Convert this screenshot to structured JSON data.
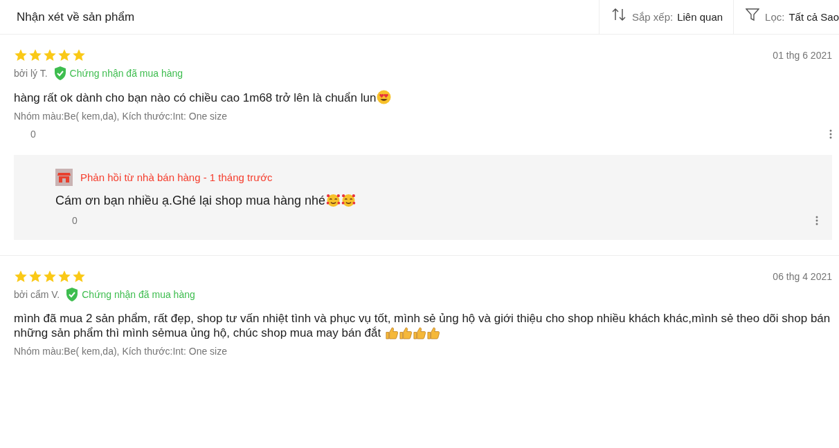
{
  "header": {
    "title": "Nhận xét về sản phẩm",
    "sort": {
      "label": "Sắp xếp:",
      "value": "Liên quan"
    },
    "filter": {
      "label": "Lọc:",
      "value": "Tất cả Sao"
    }
  },
  "reviews": [
    {
      "stars": 5,
      "date": "01 thg 6 2021",
      "author": "bởi lý T.",
      "verified": true,
      "verified_label": "Chứng nhận đã mua hàng",
      "text": "hàng rất ok dành cho bạn nào có chiều cao 1m68 trở lên  là chuẩn lun",
      "emojis": [
        {
          "kind": "heart-eyes"
        }
      ],
      "variant": "Nhóm màu:Be( kem,da), Kích thước:Int: One size",
      "likes": "0",
      "reply": {
        "title": "Phản hồi từ nhà bán hàng - 1 tháng trước",
        "text": "Cám ơn bạn nhiều ạ.Ghé lại shop mua hàng nhé",
        "emojis": [
          {
            "kind": "hearts-smile"
          },
          {
            "kind": "hearts-smile"
          }
        ],
        "likes": "0"
      }
    },
    {
      "stars": 5,
      "date": "06 thg 4 2021",
      "author": "bởi cẩm V.",
      "verified": true,
      "verified_label": "Chứng nhận đã mua hàng",
      "text": "mình đã mua 2 sản phẩm, rất đẹp, shop tư vấn nhiệt tình và phục vụ tốt, mình sẻ ủng hộ và giới thiệu cho shop nhiều khách khác,mình sẻ theo dõi shop bán những sản phẩm thì mình sẻmua ủng hộ, chúc shop mua may bán đắt ",
      "emojis": [
        {
          "kind": "thumbs-up"
        },
        {
          "kind": "thumbs-up"
        },
        {
          "kind": "thumbs-up"
        },
        {
          "kind": "thumbs-up"
        }
      ],
      "variant": "Nhóm màu:Be( kem,da), Kích thước:Int: One size"
    }
  ]
}
